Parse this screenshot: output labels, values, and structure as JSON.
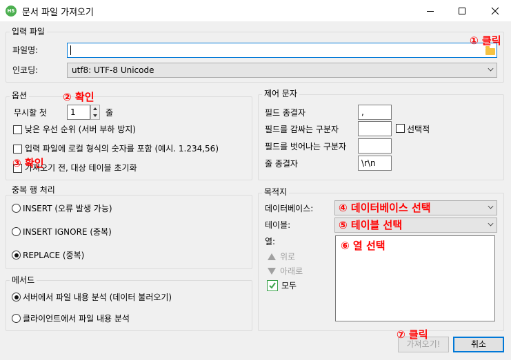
{
  "window": {
    "title": "문서 파일 가져오기",
    "icon_text": "HS"
  },
  "input_file": {
    "group_label": "입력 파일",
    "file_name_label": "파일명:",
    "file_name_value": "",
    "encoding_label": "인코딩:",
    "encoding_value": "utf8: UTF-8 Unicode"
  },
  "options": {
    "group_label": "옵션",
    "ignore_first_label": "무시할 첫",
    "ignore_first_value": "1",
    "ignore_first_unit": "줄",
    "low_priority_label": "낮은 우선 순위 (서버 부하 방지)",
    "local_number_label": "입력 파일에 로컬 형식의 숫자를 포함 (예시. 1.234,56)",
    "truncate_label": "가져오기 전, 대상 테이블 초기화"
  },
  "control_chars": {
    "group_label": "제어 문자",
    "field_terminator_label": "필드 종결자",
    "field_terminator_value": ",",
    "field_enclosed_label": "필드를 감싸는 구분자",
    "field_enclosed_value": "",
    "optional_label": "선택적",
    "field_escaped_label": "필드를 벗어나는 구분자",
    "field_escaped_value": "",
    "line_terminator_label": "줄 종결자",
    "line_terminator_value": "\\r\\n"
  },
  "duplicates": {
    "group_label": "중복 행 처리",
    "insert_label": "INSERT (오류 발생 가능)",
    "insert_ignore_label": "INSERT IGNORE (중복)",
    "replace_label": "REPLACE (중복)",
    "selected": "replace"
  },
  "method": {
    "group_label": "메서드",
    "server_label": "서버에서 파일 내용 분석 (데이터 불러오기)",
    "client_label": "클라이언트에서 파일 내용 분석",
    "selected": "server"
  },
  "target": {
    "group_label": "목적지",
    "database_label": "데이터베이스:",
    "table_label": "테이블:",
    "columns_label": "열:",
    "up_label": "위로",
    "down_label": "아래로",
    "all_label": "모두"
  },
  "buttons": {
    "import_label": "가져오기!",
    "cancel_label": "취소"
  },
  "annotations": {
    "a1": "① 클릭",
    "a2": "② 확인",
    "a3": "③ 확인",
    "a4": "④ 데이터베이스 선택",
    "a5": "⑤ 테이블  선택",
    "a6": "⑥ 열 선택",
    "a7": "⑦ 클릭"
  },
  "colors": {
    "annotation": "#ff0000",
    "accent": "#0078d7",
    "check_green": "#3aa24a"
  }
}
